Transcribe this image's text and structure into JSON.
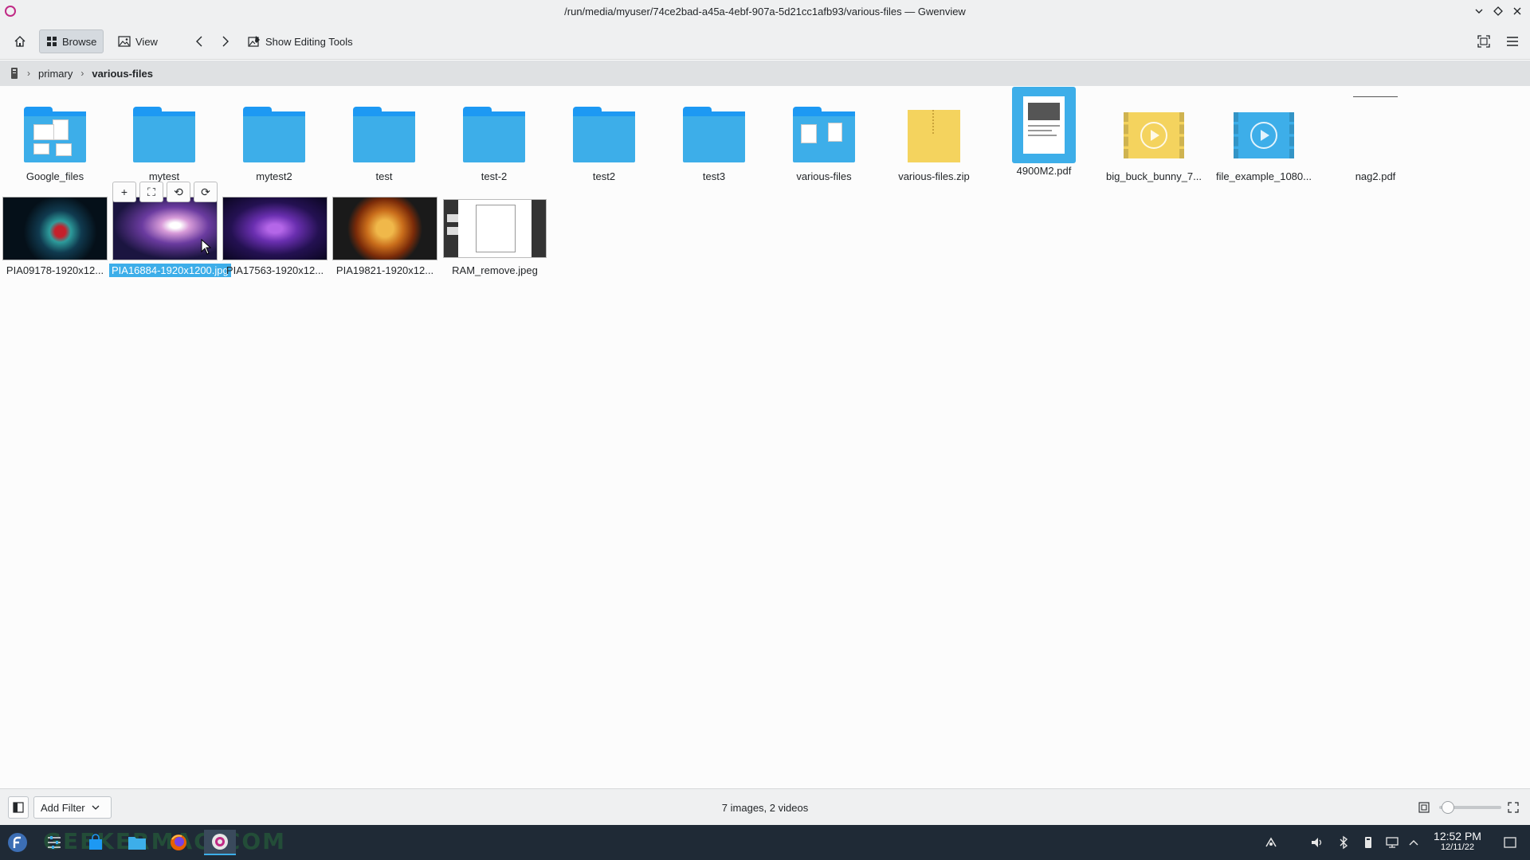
{
  "window": {
    "title": "/run/media/myuser/74ce2bad-a45a-4ebf-907a-5d21cc1afb93/various-files — Gwenview"
  },
  "toolbar": {
    "browse_label": "Browse",
    "view_label": "View",
    "editing_tools_label": "Show Editing Tools"
  },
  "breadcrumb": {
    "items": [
      "primary",
      "various-files"
    ]
  },
  "files": [
    {
      "name": "Google_files",
      "kind": "folder-docs"
    },
    {
      "name": "mytest",
      "kind": "folder"
    },
    {
      "name": "mytest2",
      "kind": "folder"
    },
    {
      "name": "test",
      "kind": "folder"
    },
    {
      "name": "test-2",
      "kind": "folder"
    },
    {
      "name": "test2",
      "kind": "folder"
    },
    {
      "name": "test3",
      "kind": "folder"
    },
    {
      "name": "various-files",
      "kind": "folder-docs"
    },
    {
      "name": "various-files.zip",
      "kind": "zip"
    },
    {
      "name": "4900M2.pdf",
      "kind": "pdf",
      "selected": true
    },
    {
      "name": "big_buck_bunny_7...",
      "kind": "video-yellow"
    },
    {
      "name": "file_example_1080...",
      "kind": "video-blue"
    },
    {
      "name": "nag2.pdf",
      "kind": "pdf-plain"
    },
    {
      "name": "PIA09178-1920x12...",
      "kind": "image-helix"
    },
    {
      "name": "PIA16884-1920x1200.jpg",
      "kind": "image-nebula",
      "hovered": true
    },
    {
      "name": "PIA17563-1920x12...",
      "kind": "image-crab"
    },
    {
      "name": "PIA19821-1920x12...",
      "kind": "image-sun"
    },
    {
      "name": "RAM_remove.jpeg",
      "kind": "image-ram"
    }
  ],
  "hover_overlay": {
    "buttons": [
      "+",
      "⛶",
      "⟲",
      "⟳"
    ]
  },
  "statusbar": {
    "add_filter_label": "Add Filter",
    "status_text": "7 images, 2 videos",
    "zoom_slider_fraction": 0.05
  },
  "taskbar": {
    "time": "12:52 PM",
    "date": "12/11/22",
    "watermark": "GEEKERMAG.COM"
  },
  "colors": {
    "accent": "#3daee9",
    "folder": "#3daee9",
    "zip": "#f4d35e",
    "taskbar": "#1f2a36"
  }
}
